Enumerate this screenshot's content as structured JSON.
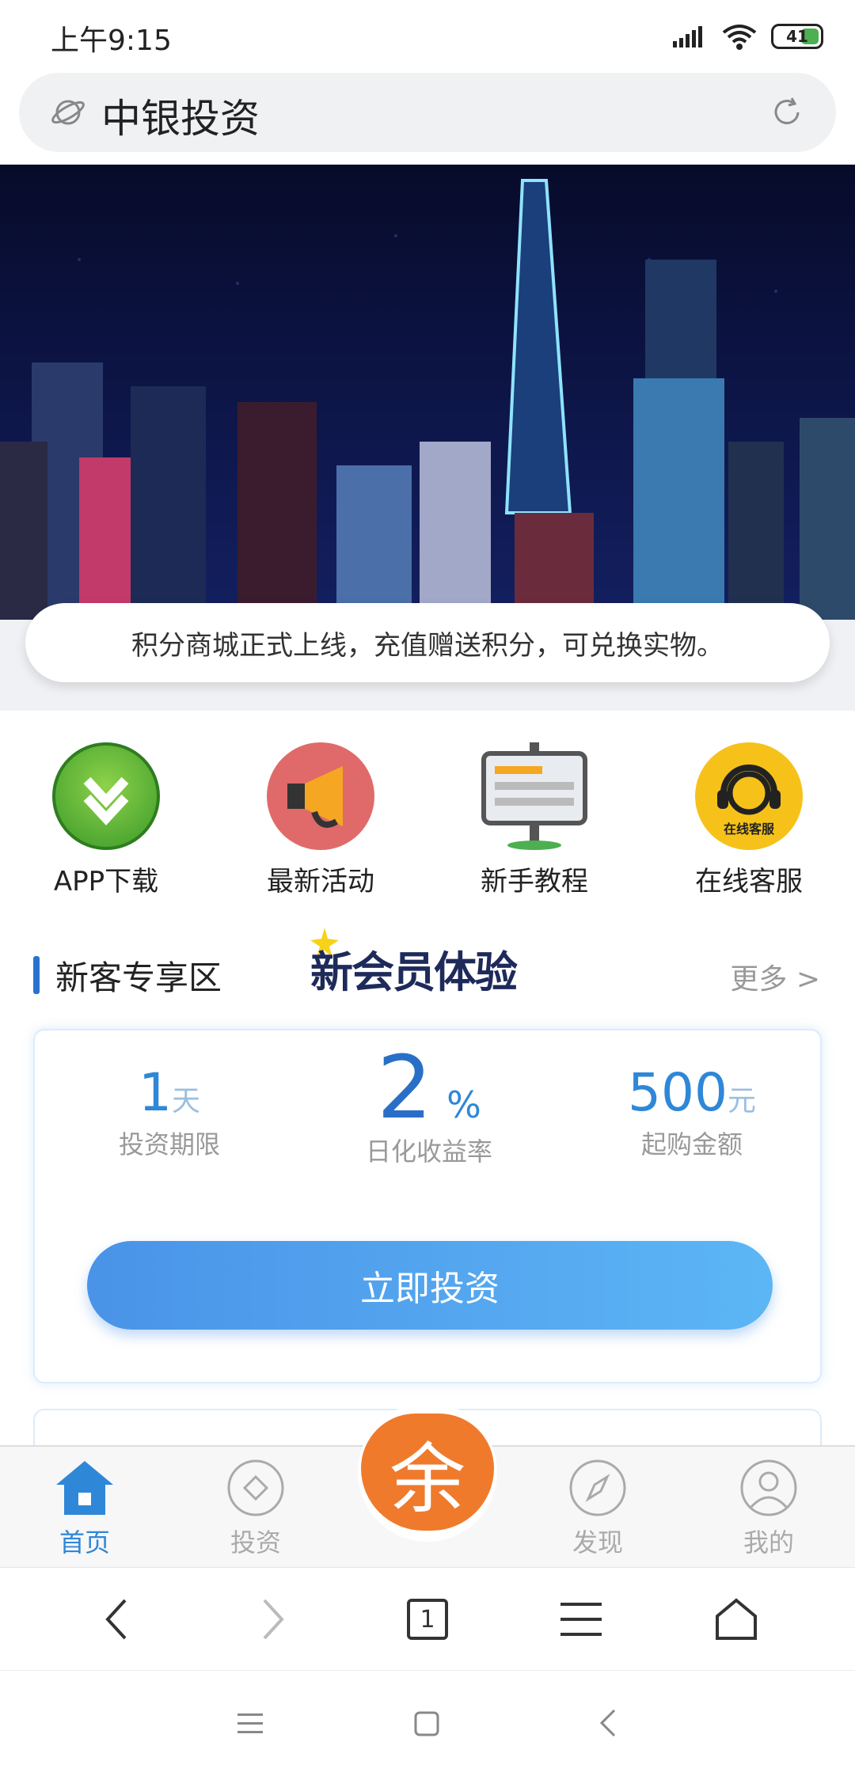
{
  "status_bar": {
    "time": "上午9:15",
    "battery": "41"
  },
  "url_bar": {
    "title": "中银投资"
  },
  "notice": {
    "text": "积分商城正式上线，充值赠送积分，可兑换实物。"
  },
  "quick_links": [
    {
      "label": "APP下载",
      "icon": "download-icon"
    },
    {
      "label": "最新活动",
      "icon": "megaphone-icon"
    },
    {
      "label": "新手教程",
      "icon": "billboard-icon"
    },
    {
      "label": "在线客服",
      "icon": "headset-icon",
      "badge": "在线客服"
    }
  ],
  "section": {
    "title": "新客专享区",
    "promo": "新会员体验",
    "more": "更多 >"
  },
  "product": {
    "term_value": "1",
    "term_unit": "天",
    "term_label": "投资期限",
    "rate_value": "2",
    "rate_unit": "%",
    "rate_label": "日化收益率",
    "min_value": "500",
    "min_unit": "元",
    "min_label": "起购金额",
    "button": "立即投资"
  },
  "tabbar": {
    "home": "首页",
    "invest": "投资",
    "center": "余",
    "discover": "发现",
    "mine": "我的"
  },
  "browser_nav": {
    "tabs_count": "1"
  },
  "colors": {
    "accent": "#2f87d7",
    "orange": "#f07a2c"
  }
}
